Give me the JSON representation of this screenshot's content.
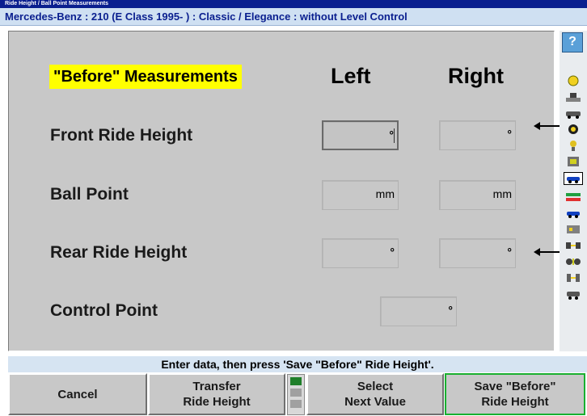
{
  "window": {
    "title": "Ride Height / Ball Point Measurements",
    "vehicle": "Mercedes-Benz : 210 (E Class 1995- ) : Classic / Elegance : without Level Control"
  },
  "measurements": {
    "heading": "\"Before\" Measurements",
    "col_left": "Left",
    "col_right": "Right",
    "rows": [
      {
        "label": "Front Ride Height",
        "left_unit": "°",
        "right_unit": "°"
      },
      {
        "label": "Ball Point",
        "left_unit": "mm",
        "right_unit": "mm"
      },
      {
        "label": "Rear Ride Height",
        "left_unit": "°",
        "right_unit": "°"
      },
      {
        "label": "Control Point",
        "unit": "°"
      }
    ]
  },
  "sidebar": {
    "help_label": "?",
    "icons": [
      "help-icon",
      "ride-height-icon",
      "lift-icon",
      "vehicle-icon",
      "tire-icon",
      "measure-icon",
      "sensor-icon",
      "car-selected-icon",
      "alignment-icon",
      "angle-icon",
      "gauge-icon",
      "chassis-icon",
      "tools-icon"
    ]
  },
  "status": {
    "instruction": "Enter data, then press 'Save \"Before\" Ride Height'."
  },
  "footer": {
    "cancel": "Cancel",
    "transfer": "Transfer\nRide Height",
    "select_next": "Select\nNext Value",
    "save": "Save \"Before\"\nRide Height"
  },
  "colors": {
    "title_bar": "#0a1f8f",
    "highlight": "#ffff00",
    "primary_border": "#19b030",
    "panel": "#c8c8c8"
  }
}
